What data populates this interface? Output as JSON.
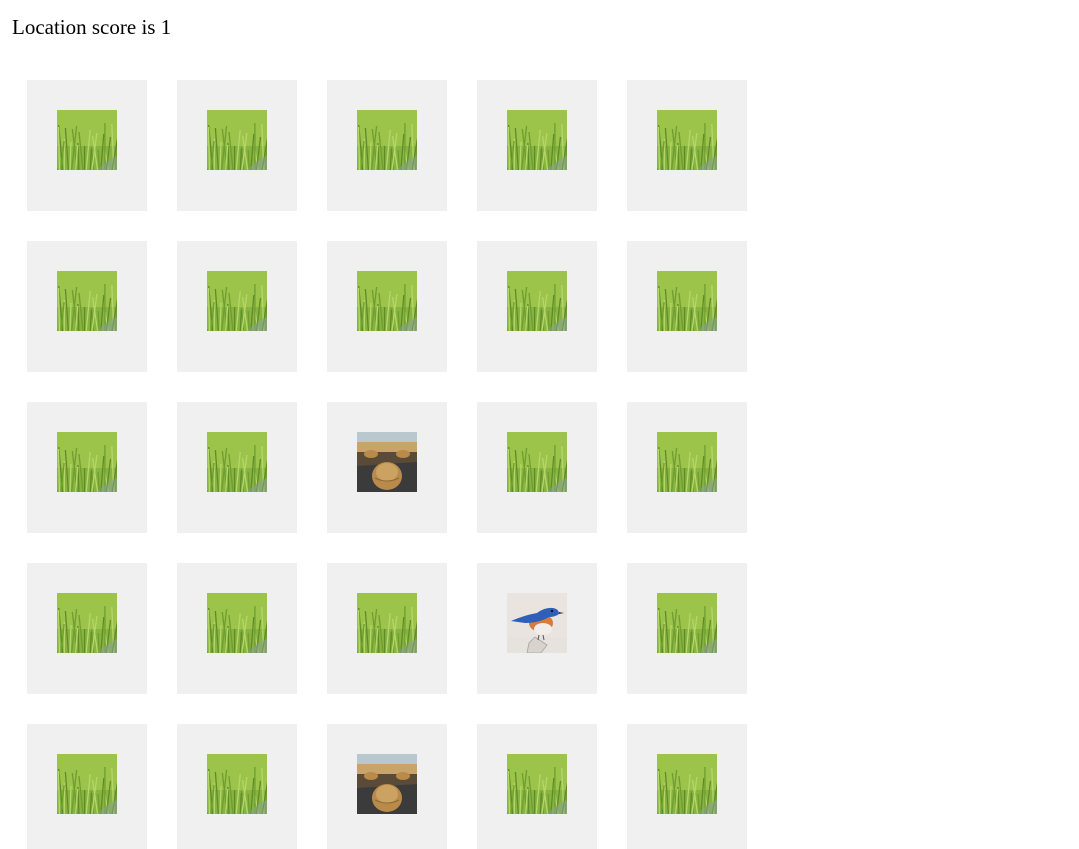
{
  "header": {
    "score_text": "Location score is 1"
  },
  "grid": {
    "rows": 5,
    "cols": 5,
    "cells": [
      [
        "grass",
        "grass",
        "grass",
        "grass",
        "grass"
      ],
      [
        "grass",
        "grass",
        "grass",
        "grass",
        "grass"
      ],
      [
        "grass",
        "grass",
        "straw-hay",
        "grass",
        "grass"
      ],
      [
        "grass",
        "grass",
        "grass",
        "bluebird",
        "grass"
      ],
      [
        "grass",
        "grass",
        "straw-hay",
        "grass",
        "grass"
      ]
    ]
  },
  "colors": {
    "cell_background": "#f0f0f0",
    "grass_light": "#9cc34a",
    "grass_dark": "#5f8c2a",
    "bird_blue": "#2f5fb8",
    "bird_orange": "#d77a3a",
    "hay_gold": "#b98a4a",
    "hay_shadow": "#3b3b3b"
  }
}
